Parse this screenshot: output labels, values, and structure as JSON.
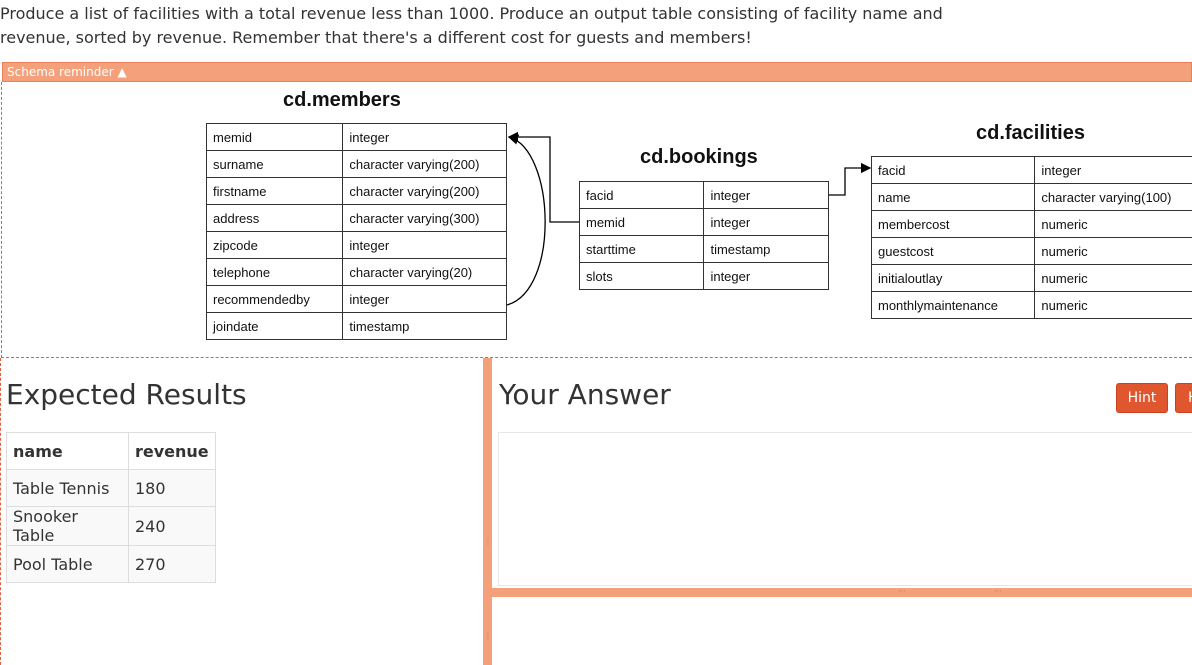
{
  "question": {
    "line1": "Produce a list of facilities with a total revenue less than 1000. Produce an output table consisting of facility name and",
    "line2": "revenue, sorted by revenue. Remember that there's a different cost for guests and members!"
  },
  "schema": {
    "toggle_label": "Schema reminder ▲",
    "members": {
      "title": "cd.members",
      "rows": [
        [
          "memid",
          "integer"
        ],
        [
          "surname",
          "character varying(200)"
        ],
        [
          "firstname",
          "character varying(200)"
        ],
        [
          "address",
          "character varying(300)"
        ],
        [
          "zipcode",
          "integer"
        ],
        [
          "telephone",
          "character varying(20)"
        ],
        [
          "recommendedby",
          "integer"
        ],
        [
          "joindate",
          "timestamp"
        ]
      ]
    },
    "bookings": {
      "title": "cd.bookings",
      "rows": [
        [
          "facid",
          "integer"
        ],
        [
          "memid",
          "integer"
        ],
        [
          "starttime",
          "timestamp"
        ],
        [
          "slots",
          "integer"
        ]
      ]
    },
    "facilities": {
      "title": "cd.facilities",
      "rows": [
        [
          "facid",
          "integer"
        ],
        [
          "name",
          "character varying(100)"
        ],
        [
          "membercost",
          "numeric"
        ],
        [
          "guestcost",
          "numeric"
        ],
        [
          "initialoutlay",
          "numeric"
        ],
        [
          "monthlymaintenance",
          "numeric"
        ]
      ]
    }
  },
  "expected": {
    "title": "Expected Results",
    "headers": [
      "name",
      "revenue"
    ],
    "rows": [
      [
        "Table Tennis",
        "180"
      ],
      [
        "Snooker Table",
        "240"
      ],
      [
        "Pool Table",
        "270"
      ]
    ]
  },
  "answer": {
    "title": "Your Answer",
    "hint_label": "Hint",
    "second_button_label": "H"
  },
  "colors": {
    "accent": "#f4a07a",
    "button": "#e0562e"
  }
}
